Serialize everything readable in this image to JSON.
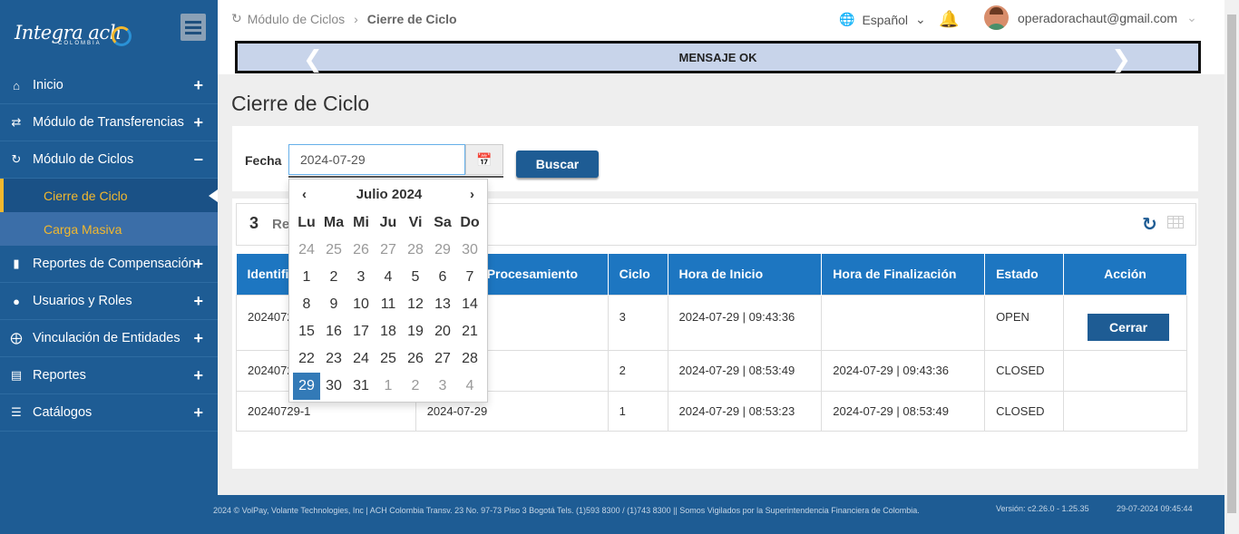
{
  "brand": {
    "logo_text": "Integra ach",
    "logo_sub": "COLOMBIA"
  },
  "sidebar": {
    "items": [
      {
        "label": "Inicio",
        "toggle": "+"
      },
      {
        "label": "Módulo de Transferencias",
        "toggle": "+"
      },
      {
        "label": "Módulo de Ciclos",
        "toggle": "−"
      },
      {
        "label": "Reportes de Compensación",
        "toggle": "+"
      },
      {
        "label": "Usuarios y Roles",
        "toggle": "+"
      },
      {
        "label": "Vinculación de Entidades",
        "toggle": "+"
      },
      {
        "label": "Reportes",
        "toggle": "+"
      },
      {
        "label": "Catálogos",
        "toggle": "+"
      }
    ],
    "submenu": [
      {
        "label": "Cierre de Ciclo",
        "active": true
      },
      {
        "label": "Carga Masiva",
        "active": false
      }
    ]
  },
  "header": {
    "breadcrumb": [
      "Módulo de Ciclos",
      "Cierre de Ciclo"
    ],
    "language": "Español",
    "user_email": "operadorachaut@gmail.com",
    "banner": "MENSAJE OK"
  },
  "page": {
    "title": "Cierre de Ciclo"
  },
  "filter": {
    "fecha_label": "Fecha",
    "date_value": "2024-07-29",
    "search_button": "Buscar"
  },
  "results": {
    "count": "3",
    "label_partial": "Re",
    "columns": [
      "Identifi",
      "Procesamiento",
      "Ciclo",
      "Hora de Inicio",
      "Hora de Finalización",
      "Estado",
      "Acción"
    ],
    "rows": [
      {
        "id": "2024072",
        "fecha": "",
        "ciclo": "3",
        "inicio": "2024-07-29 | 09:43:36",
        "fin": "",
        "estado": "OPEN",
        "accion": "Cerrar"
      },
      {
        "id": "2024072",
        "fecha": "",
        "ciclo": "2",
        "inicio": "2024-07-29 | 08:53:49",
        "fin": "2024-07-29 | 09:43:36",
        "estado": "CLOSED",
        "accion": ""
      },
      {
        "id": "20240729-1",
        "fecha": "2024-07-29",
        "ciclo": "1",
        "inicio": "2024-07-29 | 08:53:23",
        "fin": "2024-07-29 | 08:53:49",
        "estado": "CLOSED",
        "accion": ""
      }
    ]
  },
  "datepicker": {
    "month_title": "Julio 2024",
    "prev": "‹",
    "next": "›",
    "weekdays": [
      "Lu",
      "Ma",
      "Mi",
      "Ju",
      "Vi",
      "Sa",
      "Do"
    ],
    "weeks": [
      [
        "24",
        "25",
        "26",
        "27",
        "28",
        "29",
        "30"
      ],
      [
        "1",
        "2",
        "3",
        "4",
        "5",
        "6",
        "7"
      ],
      [
        "8",
        "9",
        "10",
        "11",
        "12",
        "13",
        "14"
      ],
      [
        "15",
        "16",
        "17",
        "18",
        "19",
        "20",
        "21"
      ],
      [
        "22",
        "23",
        "24",
        "25",
        "26",
        "27",
        "28"
      ],
      [
        "29",
        "30",
        "31",
        "1",
        "2",
        "3",
        "4"
      ]
    ],
    "selected": "29"
  },
  "footer": {
    "text": "2024 © VolPay, Volante Technologies, Inc | ACH Colombia Transv. 23 No. 97-73 Piso 3 Bogotá Tels. (1)593 8300 / (1)743 8300 || Somos Vigilados por la Superintendencia Financiera de Colombia.",
    "version": "Versión: c2.26.0 - 1.25.35",
    "datetime": "29-07-2024 09:45:44"
  },
  "icons": {
    "sidebar": [
      "home-icon",
      "transfer-icon",
      "refresh-icon",
      "file-icon",
      "users-icon",
      "crosshair-icon",
      "document-icon",
      "list-icon"
    ]
  },
  "colors": {
    "sidebar": "#1e5c94",
    "accent": "#f2b82e",
    "table_header": "#1d76c1",
    "banner": "#c8d4ea"
  }
}
